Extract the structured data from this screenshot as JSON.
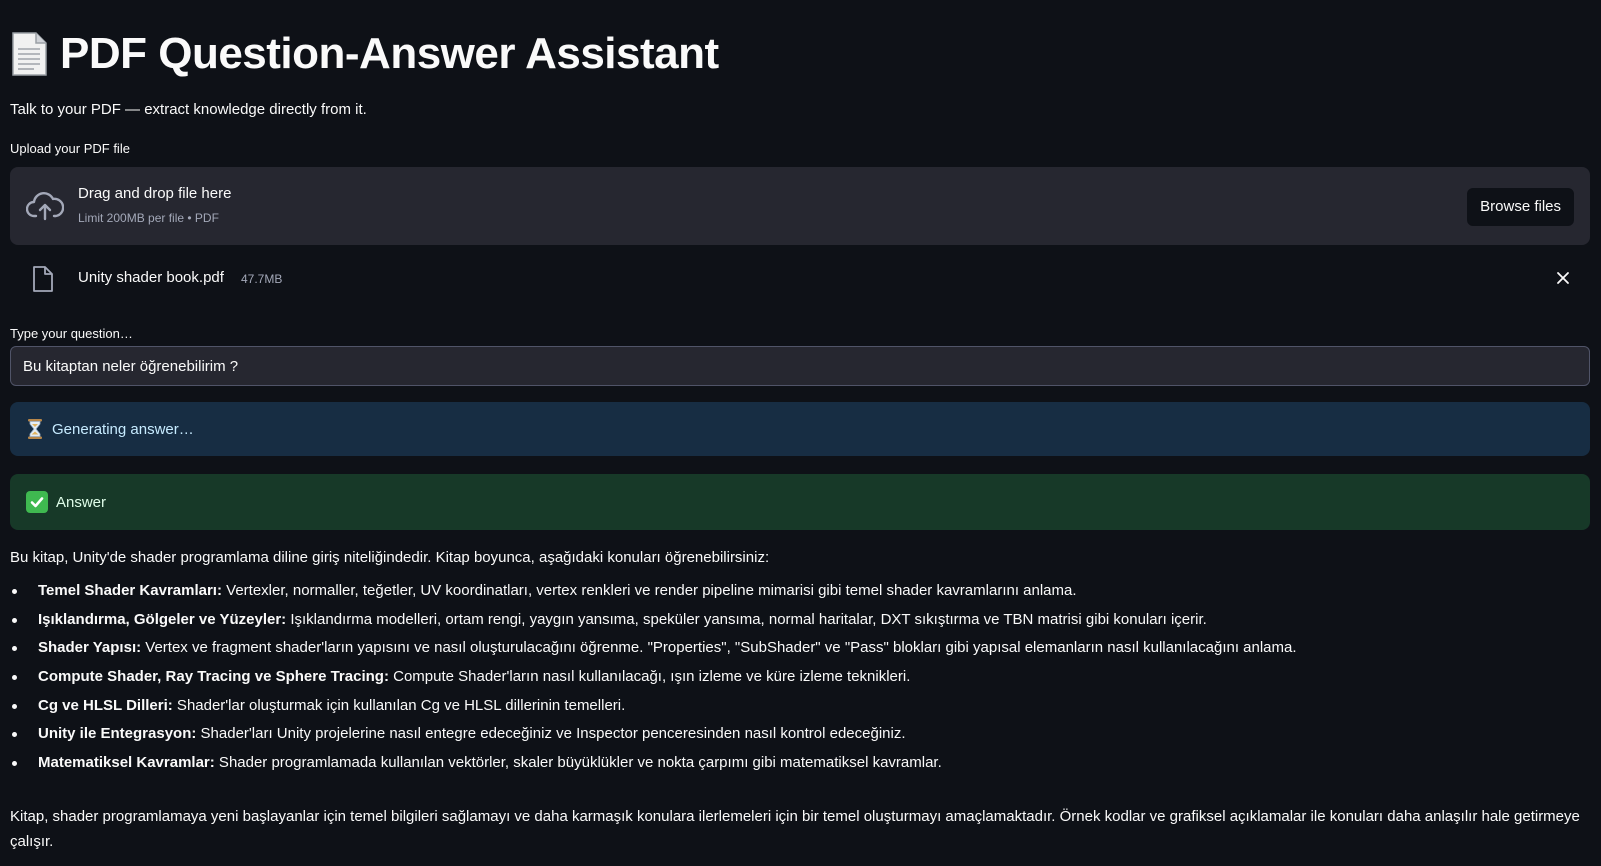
{
  "header": {
    "title": "PDF Question-Answer Assistant",
    "subtitle": "Talk to your PDF — extract knowledge directly from it."
  },
  "uploader": {
    "label": "Upload your PDF file",
    "drop_title": "Drag and drop file here",
    "drop_limit": "Limit 200MB per file • PDF",
    "browse_label": "Browse files",
    "icon": "cloud-upload-icon"
  },
  "uploaded_file": {
    "name": "Unity shader book.pdf",
    "size": "47.7MB",
    "icon": "file-icon"
  },
  "question": {
    "label": "Type your question…",
    "value": "Bu kitaptan neler öğrenebilirim ?"
  },
  "status": {
    "generating_text": "Generating answer…",
    "answer_header": "Answer"
  },
  "answer": {
    "intro": "Bu kitap, Unity'de shader programlama diline giriş niteliğindedir. Kitap boyunca, aşağıdaki konuları öğrenebilirsiniz:",
    "items": [
      {
        "title": "Temel Shader Kavramları:",
        "text": " Vertexler, normaller, teğetler, UV koordinatları, vertex renkleri ve render pipeline mimarisi gibi temel shader kavramlarını anlama."
      },
      {
        "title": "Işıklandırma, Gölgeler ve Yüzeyler:",
        "text": " Işıklandırma modelleri, ortam rengi, yaygın yansıma, speküler yansıma, normal haritalar, DXT sıkıştırma ve TBN matrisi gibi konuları içerir."
      },
      {
        "title": "Shader Yapısı:",
        "text": " Vertex ve fragment shader'ların yapısını ve nasıl oluşturulacağını öğrenme. \"Properties\", \"SubShader\" ve \"Pass\" blokları gibi yapısal elemanların nasıl kullanılacağını anlama."
      },
      {
        "title": "Compute Shader, Ray Tracing ve Sphere Tracing:",
        "text": " Compute Shader'ların nasıl kullanılacağı, ışın izleme ve küre izleme teknikleri."
      },
      {
        "title": "Cg ve HLSL Dilleri:",
        "text": " Shader'lar oluşturmak için kullanılan Cg ve HLSL dillerinin temelleri."
      },
      {
        "title": "Unity ile Entegrasyon:",
        "text": " Shader'ları Unity projelerine nasıl entegre edeceğiniz ve Inspector penceresinden nasıl kontrol edeceğiniz."
      },
      {
        "title": "Matematiksel Kavramlar:",
        "text": " Shader programlamada kullanılan vektörler, skaler büyüklükler ve nokta çarpımı gibi matematiksel kavramlar."
      }
    ],
    "conclusion": "Kitap, shader programlamaya yeni başlayanlar için temel bilgileri sağlamayı ve daha karmaşık konulara ilerlemeleri için bir temel oluşturmayı amaçlamaktadır. Örnek kodlar ve grafiksel açıklamalar ile konuları daha anlaşılır hale getirmeye çalışır."
  }
}
